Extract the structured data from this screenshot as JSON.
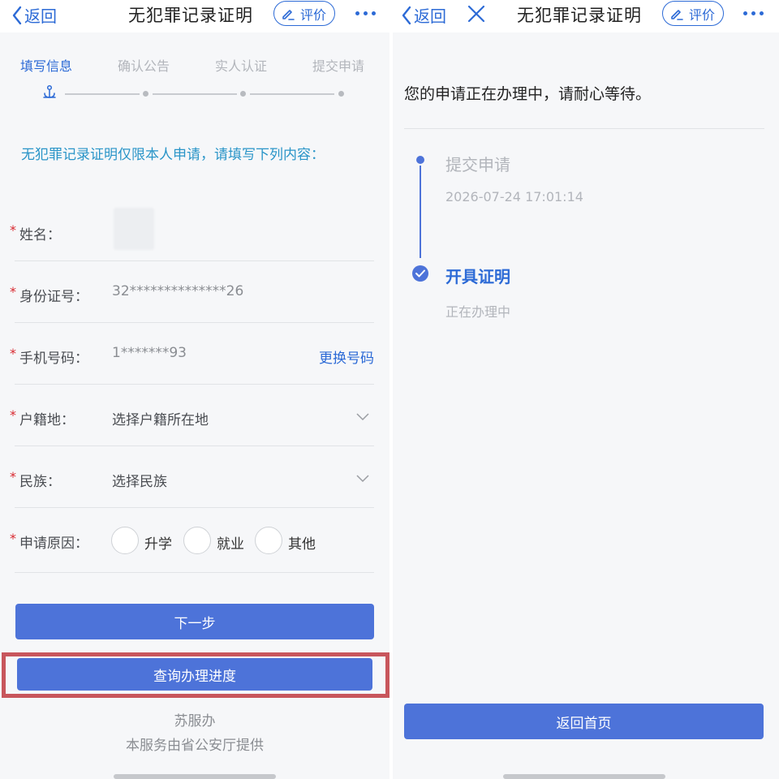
{
  "left": {
    "nav": {
      "back_label": "返回",
      "title": "无犯罪记录证明",
      "rate_label": "评价"
    },
    "steps": [
      {
        "label": "填写信息",
        "active": true
      },
      {
        "label": "确认公告",
        "active": false
      },
      {
        "label": "实人认证",
        "active": false
      },
      {
        "label": "提交申请",
        "active": false
      }
    ],
    "notice": "无犯罪记录证明仅限本人申请，请填写下列内容：",
    "form": {
      "required_mark": "*",
      "name_label": "姓名：",
      "id_label": "身份证号：",
      "id_value": "32**************26",
      "phone_label": "手机号码：",
      "phone_value": "1*******93",
      "change_phone": "更换号码",
      "residence_label": "户籍地：",
      "residence_placeholder": "选择户籍所在地",
      "ethnicity_label": "民族：",
      "ethnicity_placeholder": "选择民族",
      "reason_label": "申请原因：",
      "reason_options": [
        "升学",
        "就业",
        "其他"
      ]
    },
    "next_button": "下一步",
    "query_button": "查询办理进度",
    "footer_line1": "苏服办",
    "footer_line2": "本服务由省公安厅提供"
  },
  "right": {
    "nav": {
      "back_label": "返回",
      "title": "无犯罪记录证明",
      "rate_label": "评价"
    },
    "status_message": "您的申请正在办理中，请耐心等待。",
    "timeline": [
      {
        "title": "提交申请",
        "subtitle": "2026-07-24 17:01:14"
      },
      {
        "title": "开具证明",
        "subtitle": "正在办理中"
      }
    ],
    "home_button": "返回首页"
  },
  "colors": {
    "accent": "#2c6ad6",
    "button": "#4d73d9",
    "notice": "#2a95c8",
    "required": "#d9282f",
    "highlight": "#c8565c"
  }
}
